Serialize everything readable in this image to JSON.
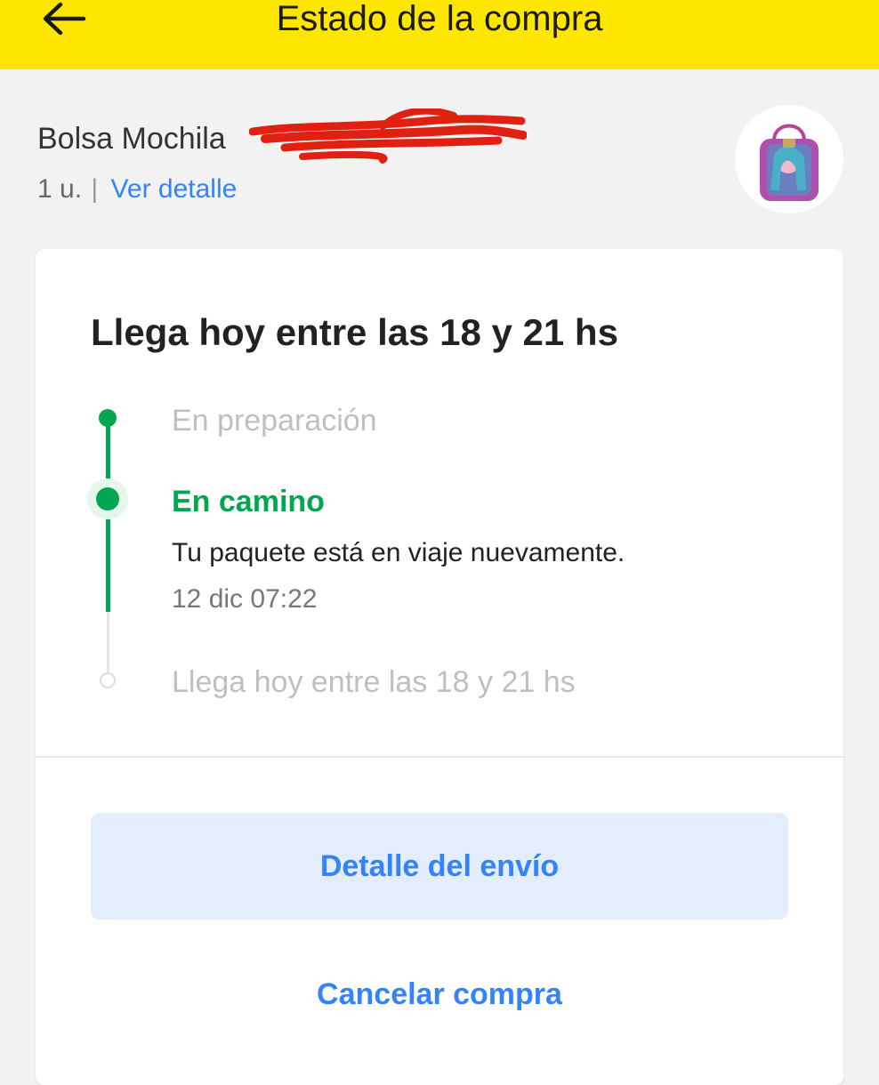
{
  "header": {
    "title": "Estado de la compra",
    "back_icon": "arrow-left-icon",
    "background": "#ffe600"
  },
  "product": {
    "name": "Bolsa Mochila",
    "quantity": "1 u.",
    "separator": "|",
    "detail_link": "Ver detalle",
    "thumbnail_icon": "backpack-bag-image"
  },
  "shipment": {
    "eta_heading": "Llega hoy entre las 18 y 21 hs",
    "steps": [
      {
        "label": "En preparación",
        "status": "done"
      },
      {
        "label": "En camino",
        "status": "current",
        "description": "Tu paquete está en viaje nuevamente.",
        "time": "12 dic 07:22"
      },
      {
        "label": "Llega hoy entre las 18 y 21 hs",
        "status": "pending"
      }
    ]
  },
  "actions": {
    "shipping_detail": "Detalle del envío",
    "cancel_purchase": "Cancelar compra"
  },
  "colors": {
    "accent_blue": "#3483fa",
    "success_green": "#00a650",
    "button_bg": "#e3edfb"
  }
}
